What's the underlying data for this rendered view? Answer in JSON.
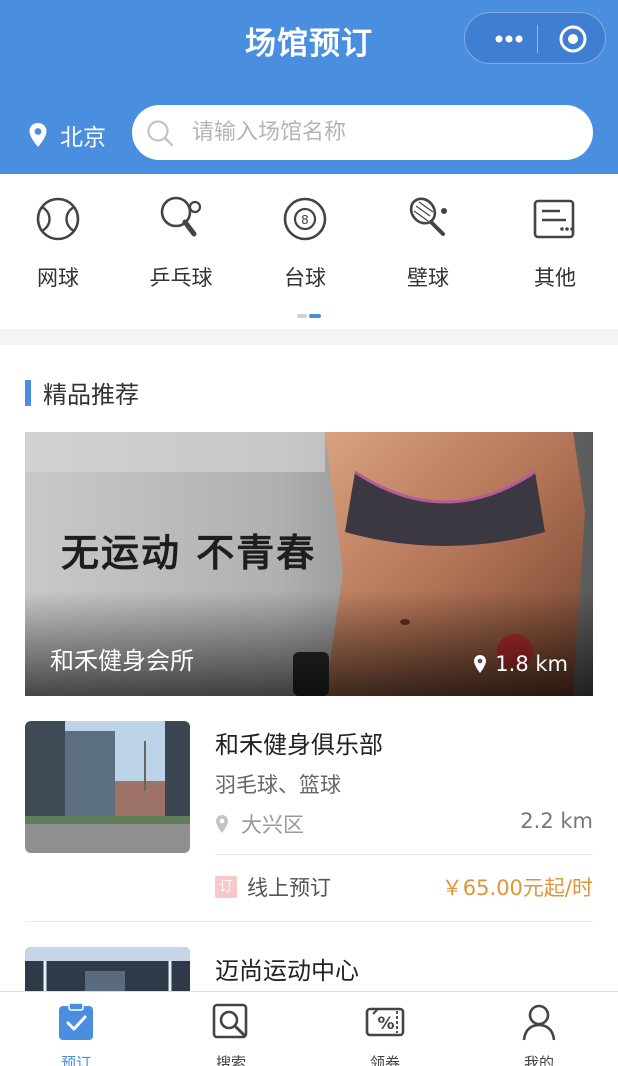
{
  "header": {
    "title": "场馆预订",
    "city": "北京",
    "search_placeholder": "请输入场馆名称"
  },
  "categories": [
    {
      "label": "网球",
      "icon": "tennis-ball-icon"
    },
    {
      "label": "乒乓球",
      "icon": "ping-pong-icon"
    },
    {
      "label": "台球",
      "icon": "billiards-icon"
    },
    {
      "label": "壁球",
      "icon": "squash-racket-icon"
    },
    {
      "label": "其他",
      "icon": "more-card-icon"
    }
  ],
  "recommend": {
    "section_title": "精品推荐",
    "banner": {
      "slogan": "无运动 不青春",
      "name": "和禾健身会所",
      "distance": "1.8 km"
    },
    "venues": [
      {
        "name": "和禾健身俱乐部",
        "sports": "羽毛球、篮球",
        "district": "大兴区",
        "distance": "2.2 km",
        "booking": "线上预订",
        "booking_badge": "订",
        "price": "￥65.00元起/时"
      },
      {
        "name": "迈尚运动中心"
      }
    ]
  },
  "tabbar": [
    {
      "label": "预订",
      "icon": "booking-icon",
      "active": true
    },
    {
      "label": "搜索",
      "icon": "search-icon",
      "active": false
    },
    {
      "label": "领券",
      "icon": "coupon-icon",
      "active": false
    },
    {
      "label": "我的",
      "icon": "profile-icon",
      "active": false
    }
  ],
  "colors": {
    "primary": "#4a8fdf",
    "price": "#e0953a",
    "badge": "#f7c8c8"
  }
}
